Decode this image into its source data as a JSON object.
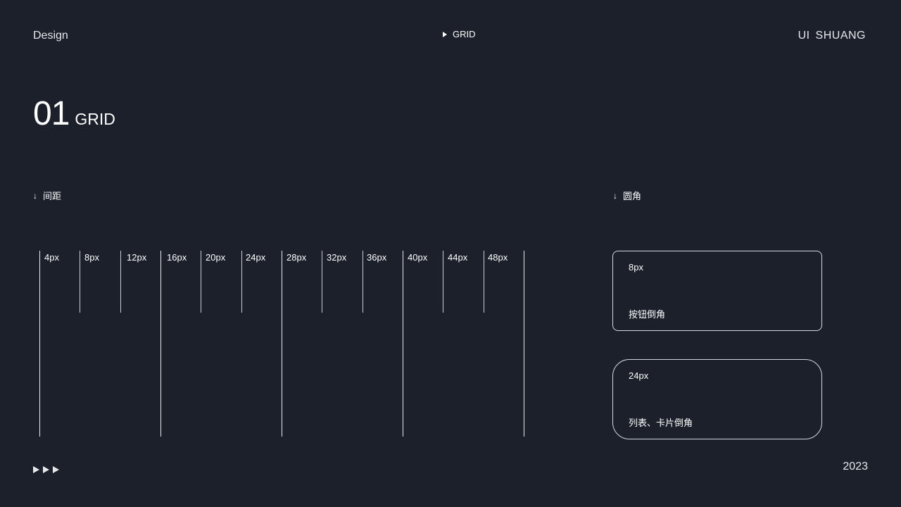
{
  "header": {
    "left": "Design",
    "center": "GRID",
    "right": "UI  SHUANG"
  },
  "title": {
    "number": "01",
    "text": "GRID"
  },
  "spacing": {
    "heading": "间距",
    "arrow": "↓",
    "items": [
      "4px",
      "8px",
      "12px",
      "16px",
      "20px",
      "24px",
      "28px",
      "32px",
      "36px",
      "40px",
      "44px",
      "48px"
    ]
  },
  "radius": {
    "heading": "圆角",
    "arrow": "↓",
    "cards": [
      {
        "value": "8px",
        "desc": "按钮倒角"
      },
      {
        "value": "24px",
        "desc": "列表、卡片倒角"
      }
    ]
  },
  "footer": {
    "year": "2023"
  },
  "colors": {
    "background": "#1b202b",
    "text": "#ffffff",
    "line": "#c9ccd3"
  }
}
